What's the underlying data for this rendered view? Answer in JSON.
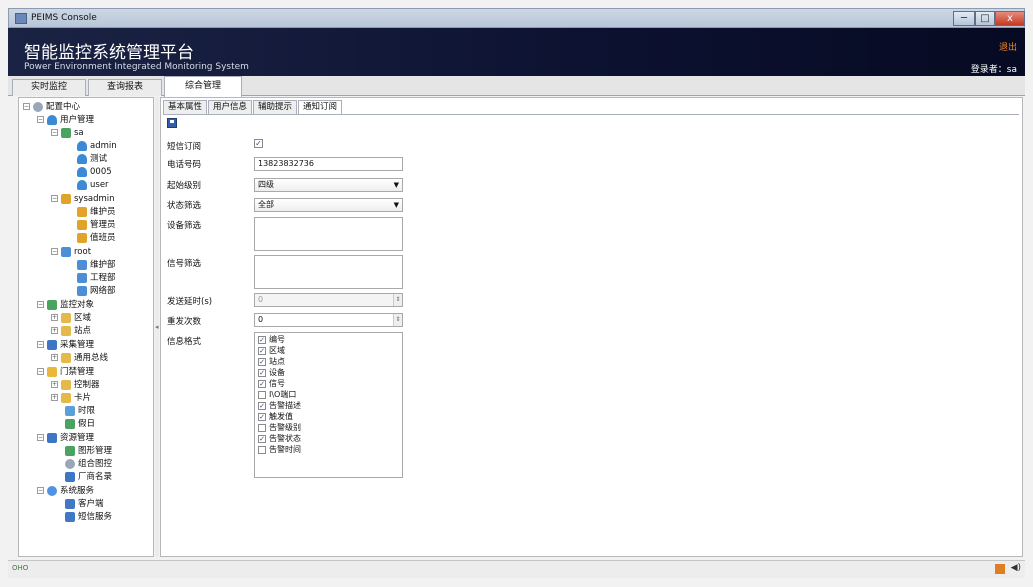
{
  "window": {
    "title": "PEIMS Console",
    "min": "─",
    "max": "□",
    "close": "x"
  },
  "header": {
    "title": "智能监控系统管理平台",
    "subtitle": "Power Environment Integrated Monitoring System",
    "logout": "退出",
    "login": "登录者：sa"
  },
  "topnav": {
    "tabs": [
      "实时监控",
      "查询报表",
      "综合管理"
    ],
    "active": 2
  },
  "tree": [
    {
      "label": "配置中心",
      "icon": "gear-icon"
    },
    {
      "label": "用户管理",
      "icon": "user-icon"
    },
    {
      "label": "sa",
      "icon": "user-icon"
    },
    {
      "label": "admin",
      "icon": "user-icon"
    },
    {
      "label": "测试",
      "icon": "user-icon"
    },
    {
      "label": "0005",
      "icon": "user-icon"
    },
    {
      "label": "user",
      "icon": "user-icon"
    },
    {
      "label": "sysadmin",
      "icon": "user-icon"
    },
    {
      "label": "维护员",
      "icon": "user-group-icon"
    },
    {
      "label": "管理员",
      "icon": "user-group-icon"
    },
    {
      "label": "值班员",
      "icon": "user-group-icon"
    },
    {
      "label": "root",
      "icon": "org-icon"
    },
    {
      "label": "维护部",
      "icon": "org-icon"
    },
    {
      "label": "工程部",
      "icon": "org-icon"
    },
    {
      "label": "网络部",
      "icon": "org-icon"
    },
    {
      "label": "监控对象",
      "icon": "monitor-icon"
    },
    {
      "label": "区域",
      "icon": "folder-icon"
    },
    {
      "label": "站点",
      "icon": "folder-icon"
    },
    {
      "label": "采集管理",
      "icon": "collect-icon"
    },
    {
      "label": "通用总线",
      "icon": "folder-icon"
    },
    {
      "label": "门禁管理",
      "icon": "lock-icon"
    },
    {
      "label": "控制器",
      "icon": "folder-icon"
    },
    {
      "label": "卡片",
      "icon": "folder-icon"
    },
    {
      "label": "时限",
      "icon": "clock-icon"
    },
    {
      "label": "假日",
      "icon": "calendar-icon"
    },
    {
      "label": "资源管理",
      "icon": "resource-icon"
    },
    {
      "label": "图形管理",
      "icon": "graphic-icon"
    },
    {
      "label": "组合图控",
      "icon": "combo-icon"
    },
    {
      "label": "厂商名录",
      "icon": "vendor-icon"
    },
    {
      "label": "系统服务",
      "icon": "service-icon"
    },
    {
      "label": "客户端",
      "icon": "client-icon"
    },
    {
      "label": "短信服务",
      "icon": "sms-icon"
    }
  ],
  "subtabs": {
    "tabs": [
      "基本属性",
      "用户信息",
      "辅助提示",
      "通知订阅"
    ],
    "active": 3
  },
  "form": {
    "sms_label": "短信订阅",
    "sms_checked": "✓",
    "phone_label": "电话号码",
    "phone_value": "13823832736",
    "level_label": "起始级别",
    "level_value": "四级",
    "status_label": "状态筛选",
    "status_value": "全部",
    "device_label": "设备筛选",
    "signal_label": "信号筛选",
    "delay_label": "发送延时(s)",
    "delay_value": "0",
    "retry_label": "重发次数",
    "retry_value": "0",
    "format_label": "信息格式",
    "format_items": [
      {
        "label": "编号",
        "checked": "✓"
      },
      {
        "label": "区域",
        "checked": "✓"
      },
      {
        "label": "站点",
        "checked": "✓"
      },
      {
        "label": "设备",
        "checked": "✓"
      },
      {
        "label": "信号",
        "checked": "✓"
      },
      {
        "label": "I\\O端口",
        "checked": ""
      },
      {
        "label": "告警描述",
        "checked": "✓"
      },
      {
        "label": "触发值",
        "checked": "✓"
      },
      {
        "label": "告警级别",
        "checked": ""
      },
      {
        "label": "告警状态",
        "checked": "✓"
      },
      {
        "label": "告警时间",
        "checked": ""
      }
    ]
  },
  "statusbar": {
    "connection": "OHO",
    "speaker": "◀)"
  },
  "colors": {
    "header_bg": "#0c1130",
    "logout": "#f08a2b",
    "accent": "#2f5fa8"
  }
}
